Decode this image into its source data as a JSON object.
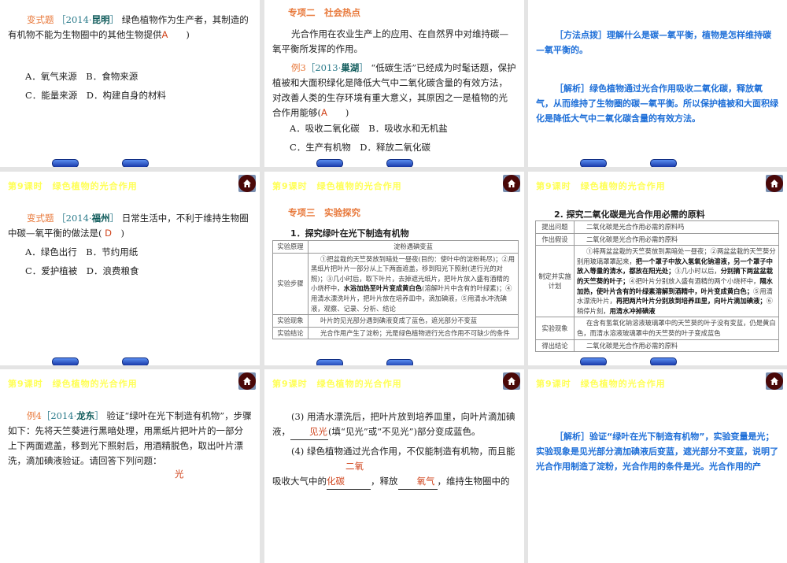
{
  "header_title": "第9课时　绿色植物的光合作用",
  "s1": {
    "tag": "变式题",
    "src_pre": "［2014·",
    "src_place": "昆明",
    "src_post": "］",
    "q1": "绿色植物作为生产者，其制造的有机物不能为生物圈中的其他生物提供",
    "answer": "A",
    "q_end": "　　)",
    "opt_ab": "A．氧气来源　B．食物来源",
    "opt_cd": "C．能量来源　D．构建自身的材料"
  },
  "s2": {
    "section": "专项二　社会热点",
    "intro": "光合作用在农业生产上的应用、在自然界中对维持碳—氧平衡所发挥的作用。",
    "tag": "例3",
    "src_pre": "［2013·",
    "src_place": "巢湖",
    "src_post": "］",
    "q": "“低碳生活”已经成为时髦话题，保护植被和大面积绿化是降低大气中二氧化碳含量的有效方法，对改善人类的生存环境有重大意义，其原因之一是植物的光合作用能够(",
    "answer": "A",
    "q_end": "　　)",
    "opt_ab": "A．吸收二氧化碳　B．吸收水和无机盐",
    "opt_cd": "C．生产有机物　D．释放二氧化碳"
  },
  "s3": {
    "method": "［方法点拨］理解什么是碳—氧平衡，植物是怎样维持碳—氧平衡的。",
    "analysis": "［解析］绿色植物通过光合作用吸收二氧化碳，释放氧气，从而维持了生物圈的碳—氧平衡。所以保护植被和大面积绿化是降低大气中二氧化碳含量的有效方法。"
  },
  "s4": {
    "tag": "变式题",
    "src_pre": "［2014·",
    "src_place": "福州",
    "src_post": "］",
    "q": "日常生活中，不利于维持生物圈中碳—氧平衡的做法是(",
    "answer": "D",
    "q_end": "　)",
    "opt_ab": "A．绿色出行　B．节约用纸",
    "opt_cd": "C．爱护植被　D．浪费粮食"
  },
  "s5": {
    "section": "专项三　实验探究",
    "subtitle": "1．探究绿叶在光下制造有机物",
    "rows": [
      {
        "k": "实验原理",
        "v": "淀粉遇碘变蓝"
      },
      {
        "k": "实验步骤",
        "v1": "①把盆栽的天竺葵放到暗处一昼夜(目的：使叶中的淀粉耗尽)；②用黑纸片把叶片一部分从上下两面遮盖，移到阳光下照射(进行光的对照)；③几小时后，取下叶片，去掉遮光纸片，把叶片放入盛有酒精的小烧杯中，",
        "bold": "水浴加热至叶片变成黄白色",
        "v2": "(溶解叶片中含有的叶绿素)；④用清水漂洗叶片，把叶片放在培养皿中，滴加碘液，⑤用清水冲洗碘液，观察、记录、分析、结论"
      },
      {
        "k": "实验现象",
        "v": "叶片的见光部分遇到碘液变成了蓝色，遮光部分不变蓝"
      },
      {
        "k": "实验结论",
        "v": "光合作用产生了淀粉；光是绿色植物进行光合作用不可缺少的条件"
      }
    ]
  },
  "s6": {
    "subtitle": "2. 探究二氧化碳是光合作用必需的原料",
    "rows": [
      {
        "k": "提出问题",
        "v": "二氧化碳是光合作用必需的原料吗"
      },
      {
        "k": "作出假设",
        "v": "二氧化碳是光合作用必需的原料"
      },
      {
        "k": "制定并实施计划",
        "p1": "①将两盆盆栽的天竺葵放到黑暗处一昼夜；②两盆盆栽的天竺葵分别用玻璃罩罩起来，",
        "b1": "把一个罩子中放入氢氧化钠溶液，另一个罩子中放入等量的清水，都放在阳光处；",
        "p2": "③几小时以后，",
        "b2": "分别摘下两盆盆栽的天竺葵的叶子；",
        "p3": "④把叶片分别放入盛有酒精的两个小烧杯中，",
        "b3": "隔水加热，使叶片含有的叶绿素溶解到酒精中，叶片变成黄白色；",
        "p4": "⑤用清水漂洗叶片，",
        "b4": "再把两片叶片分别放到培养皿里，向叶片滴加碘液；",
        "p5": "⑥稍停片刻，",
        "b5": "用清水冲掉碘液"
      },
      {
        "k": "实验现象",
        "v": "在含有氢氧化钠溶液玻璃罩中的天竺葵的叶子没有变蓝，仍是黄白色，而清水溶液玻璃罩中的天竺葵的叶子变成蓝色"
      },
      {
        "k": "得出结论",
        "v": "二氧化碳是光合作用必需的原料"
      }
    ]
  },
  "s7": {
    "tag": "例4",
    "src_pre": "［2014·",
    "src_place": "龙东",
    "src_post": "］",
    "q": "验证“绿叶在光下制造有机物”，步骤如下：先将天竺葵进行黑暗处理，用黑纸片把叶片的一部分上下两面遮盖，移到光下照射后，用酒精脱色，取出叶片漂洗，滴加碘液验证。请回答下列问题：",
    "partial_answer": "光"
  },
  "s8": {
    "q3_a": "(3) 用清水漂洗后，把叶片放到培养皿里，向叶片滴加碘液，",
    "q3_ans": "见光",
    "q3_b": "(填“见光”或“不见光”)部分变成蓝色。",
    "q4_a": "(4) 绿色植物通过光合作用，不仅能制造有机物，而且能吸收大气中的",
    "q4_ans1": "二氧化碳",
    "q4_b": "，释放",
    "q4_ans2": "氧气",
    "q4_c": "，维持生物圈中的"
  },
  "s9": {
    "analysis": "［解析］验证“绿叶在光下制造有机物”，实验变量是光；实验现象是见光部分滴加碘液后变蓝，遮光部分不变蓝，说明了光合作用制造了淀粉，光合作用的条件是光。光合作用的产"
  }
}
